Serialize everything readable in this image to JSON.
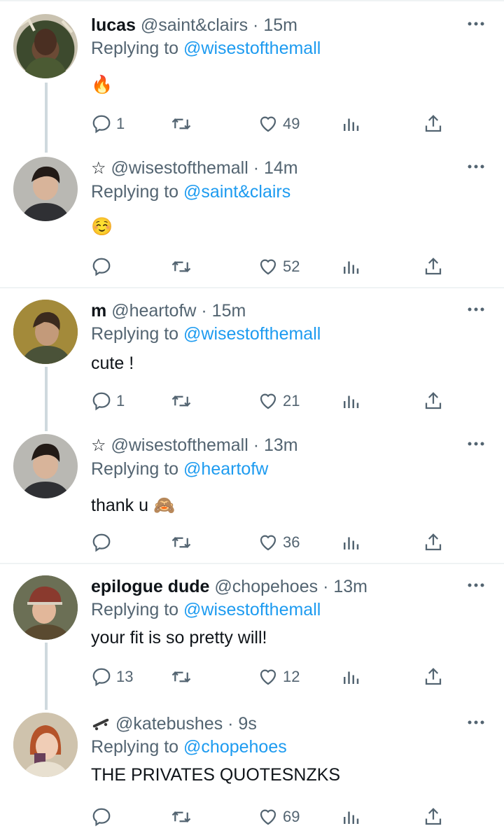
{
  "colors": {
    "accent": "#1d9bf0",
    "muted": "#536471",
    "text": "#0f1419",
    "divider": "#eff3f4",
    "thread": "#cfd9de"
  },
  "tweets": [
    {
      "name": "lucas",
      "handle": "@saint&clairs",
      "time": "15m",
      "reply_to": "@wisestofthemall",
      "text": "🔥",
      "replies": "1",
      "likes": "49",
      "icon": "none"
    },
    {
      "name": "",
      "handle": "@wisestofthemall",
      "time": "14m",
      "reply_to": "@saint&clairs",
      "text": "☺️",
      "replies": "",
      "likes": "52",
      "icon": "star-icon"
    },
    {
      "name": "m",
      "handle": "@heartofw",
      "time": "15m",
      "reply_to": "@wisestofthemall",
      "text": "cute !",
      "replies": "1",
      "likes": "21",
      "icon": "none"
    },
    {
      "name": "",
      "handle": "@wisestofthemall",
      "time": "13m",
      "reply_to": "@heartofw",
      "text": "thank u 🙈",
      "replies": "",
      "likes": "36",
      "icon": "star-icon"
    },
    {
      "name": "epilogue dude",
      "handle": "@chopehoes",
      "time": "13m",
      "reply_to": "@wisestofthemall",
      "text": "your fit is so pretty will!",
      "replies": "13",
      "likes": "12",
      "icon": "none"
    },
    {
      "name": "",
      "handle": "@katebushes",
      "time": "9s",
      "reply_to": "@chopehoes",
      "text": "THE PRIVATES QUOTESNZKS",
      "replies": "",
      "likes": "69",
      "icon": "skateboard-icon"
    }
  ],
  "labels": {
    "replying_to": "Replying to",
    "dot": " · "
  }
}
